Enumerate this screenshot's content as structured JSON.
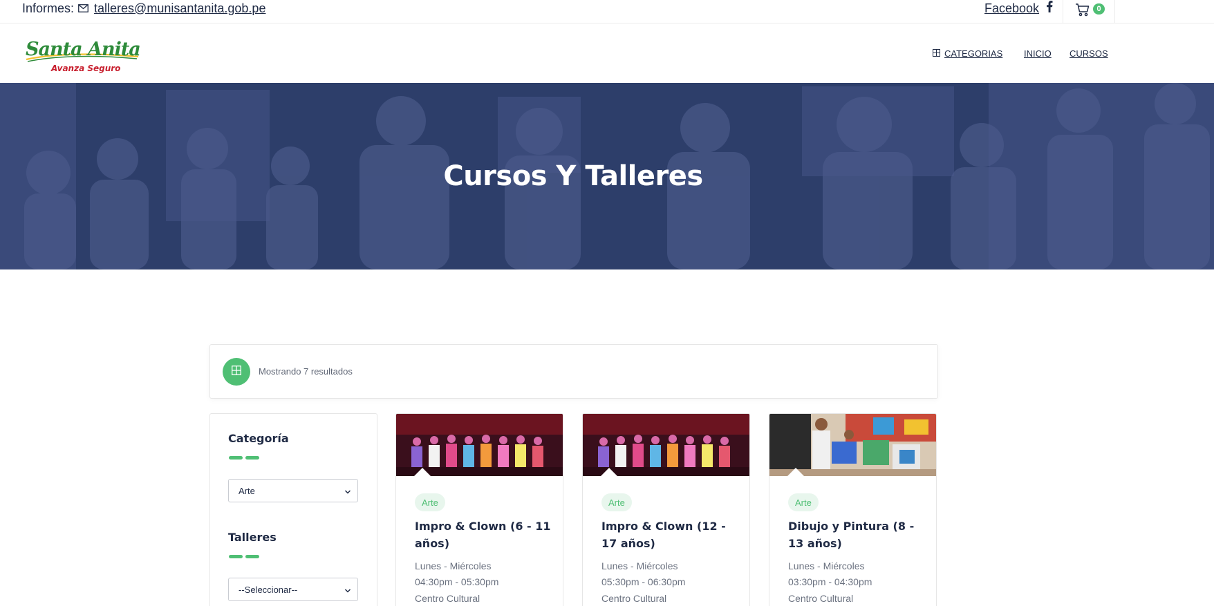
{
  "topbar": {
    "informes_label": "Informes:",
    "email": "talleres@munisantanita.gob.pe",
    "facebook_label": "Facebook",
    "cart_count": "0"
  },
  "logo": {
    "main": "Santa Anita",
    "tagline": "Avanza Seguro"
  },
  "nav": {
    "categorias": "CATEGORIAS",
    "inicio": "INICIO",
    "cursos": "CURSOS"
  },
  "hero": {
    "title": "Cursos Y Talleres"
  },
  "results": {
    "text": "Mostrando 7 resultados"
  },
  "sidebar": {
    "categoria_title": "Categoría",
    "categoria_value": "Arte",
    "talleres_title": "Talleres",
    "talleres_value": "--Seleccionar--"
  },
  "courses": [
    {
      "tag": "Arte",
      "title": "Impro & Clown (6 - 11 años)",
      "days": "Lunes - Miércoles",
      "time": "04:30pm - 05:30pm",
      "place": "Centro Cultural"
    },
    {
      "tag": "Arte",
      "title": "Impro & Clown (12 - 17 años)",
      "days": "Lunes - Miércoles",
      "time": "05:30pm - 06:30pm",
      "place": "Centro Cultural"
    },
    {
      "tag": "Arte",
      "title": "Dibujo y Pintura (8 - 13 años)",
      "days": "Lunes - Miércoles",
      "time": "03:30pm - 04:30pm",
      "place": "Centro Cultural"
    }
  ],
  "colors": {
    "accent": "#4fbf74",
    "navy": "#1f2a44",
    "hero_overlay": "#2c3c68"
  }
}
